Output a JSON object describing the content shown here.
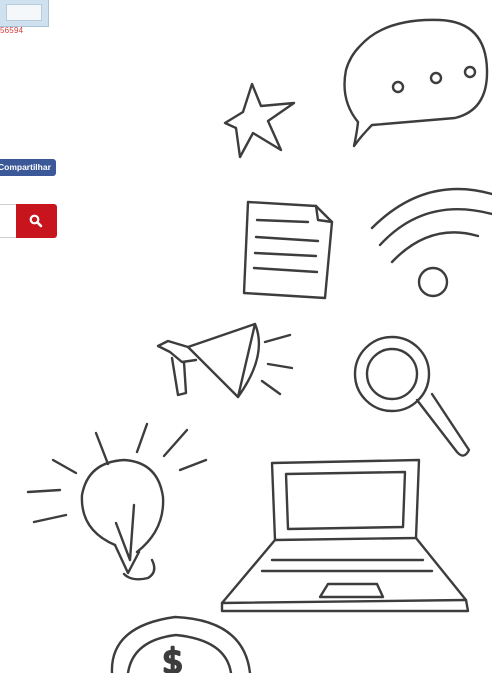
{
  "widget": {
    "counter_text": "56594"
  },
  "share": {
    "label": "Compartilhar"
  },
  "search": {
    "value": "",
    "button_icon": "search-icon",
    "button_color": "#c8141c"
  },
  "illustration": {
    "icons": [
      "star-icon",
      "speech-bubble-icon",
      "document-icon",
      "wifi-icon",
      "megaphone-icon",
      "magnifier-icon",
      "lightbulb-icon",
      "laptop-icon",
      "coin-icon"
    ],
    "coin_symbol": "$",
    "stroke_color": "#3d3d3d"
  }
}
